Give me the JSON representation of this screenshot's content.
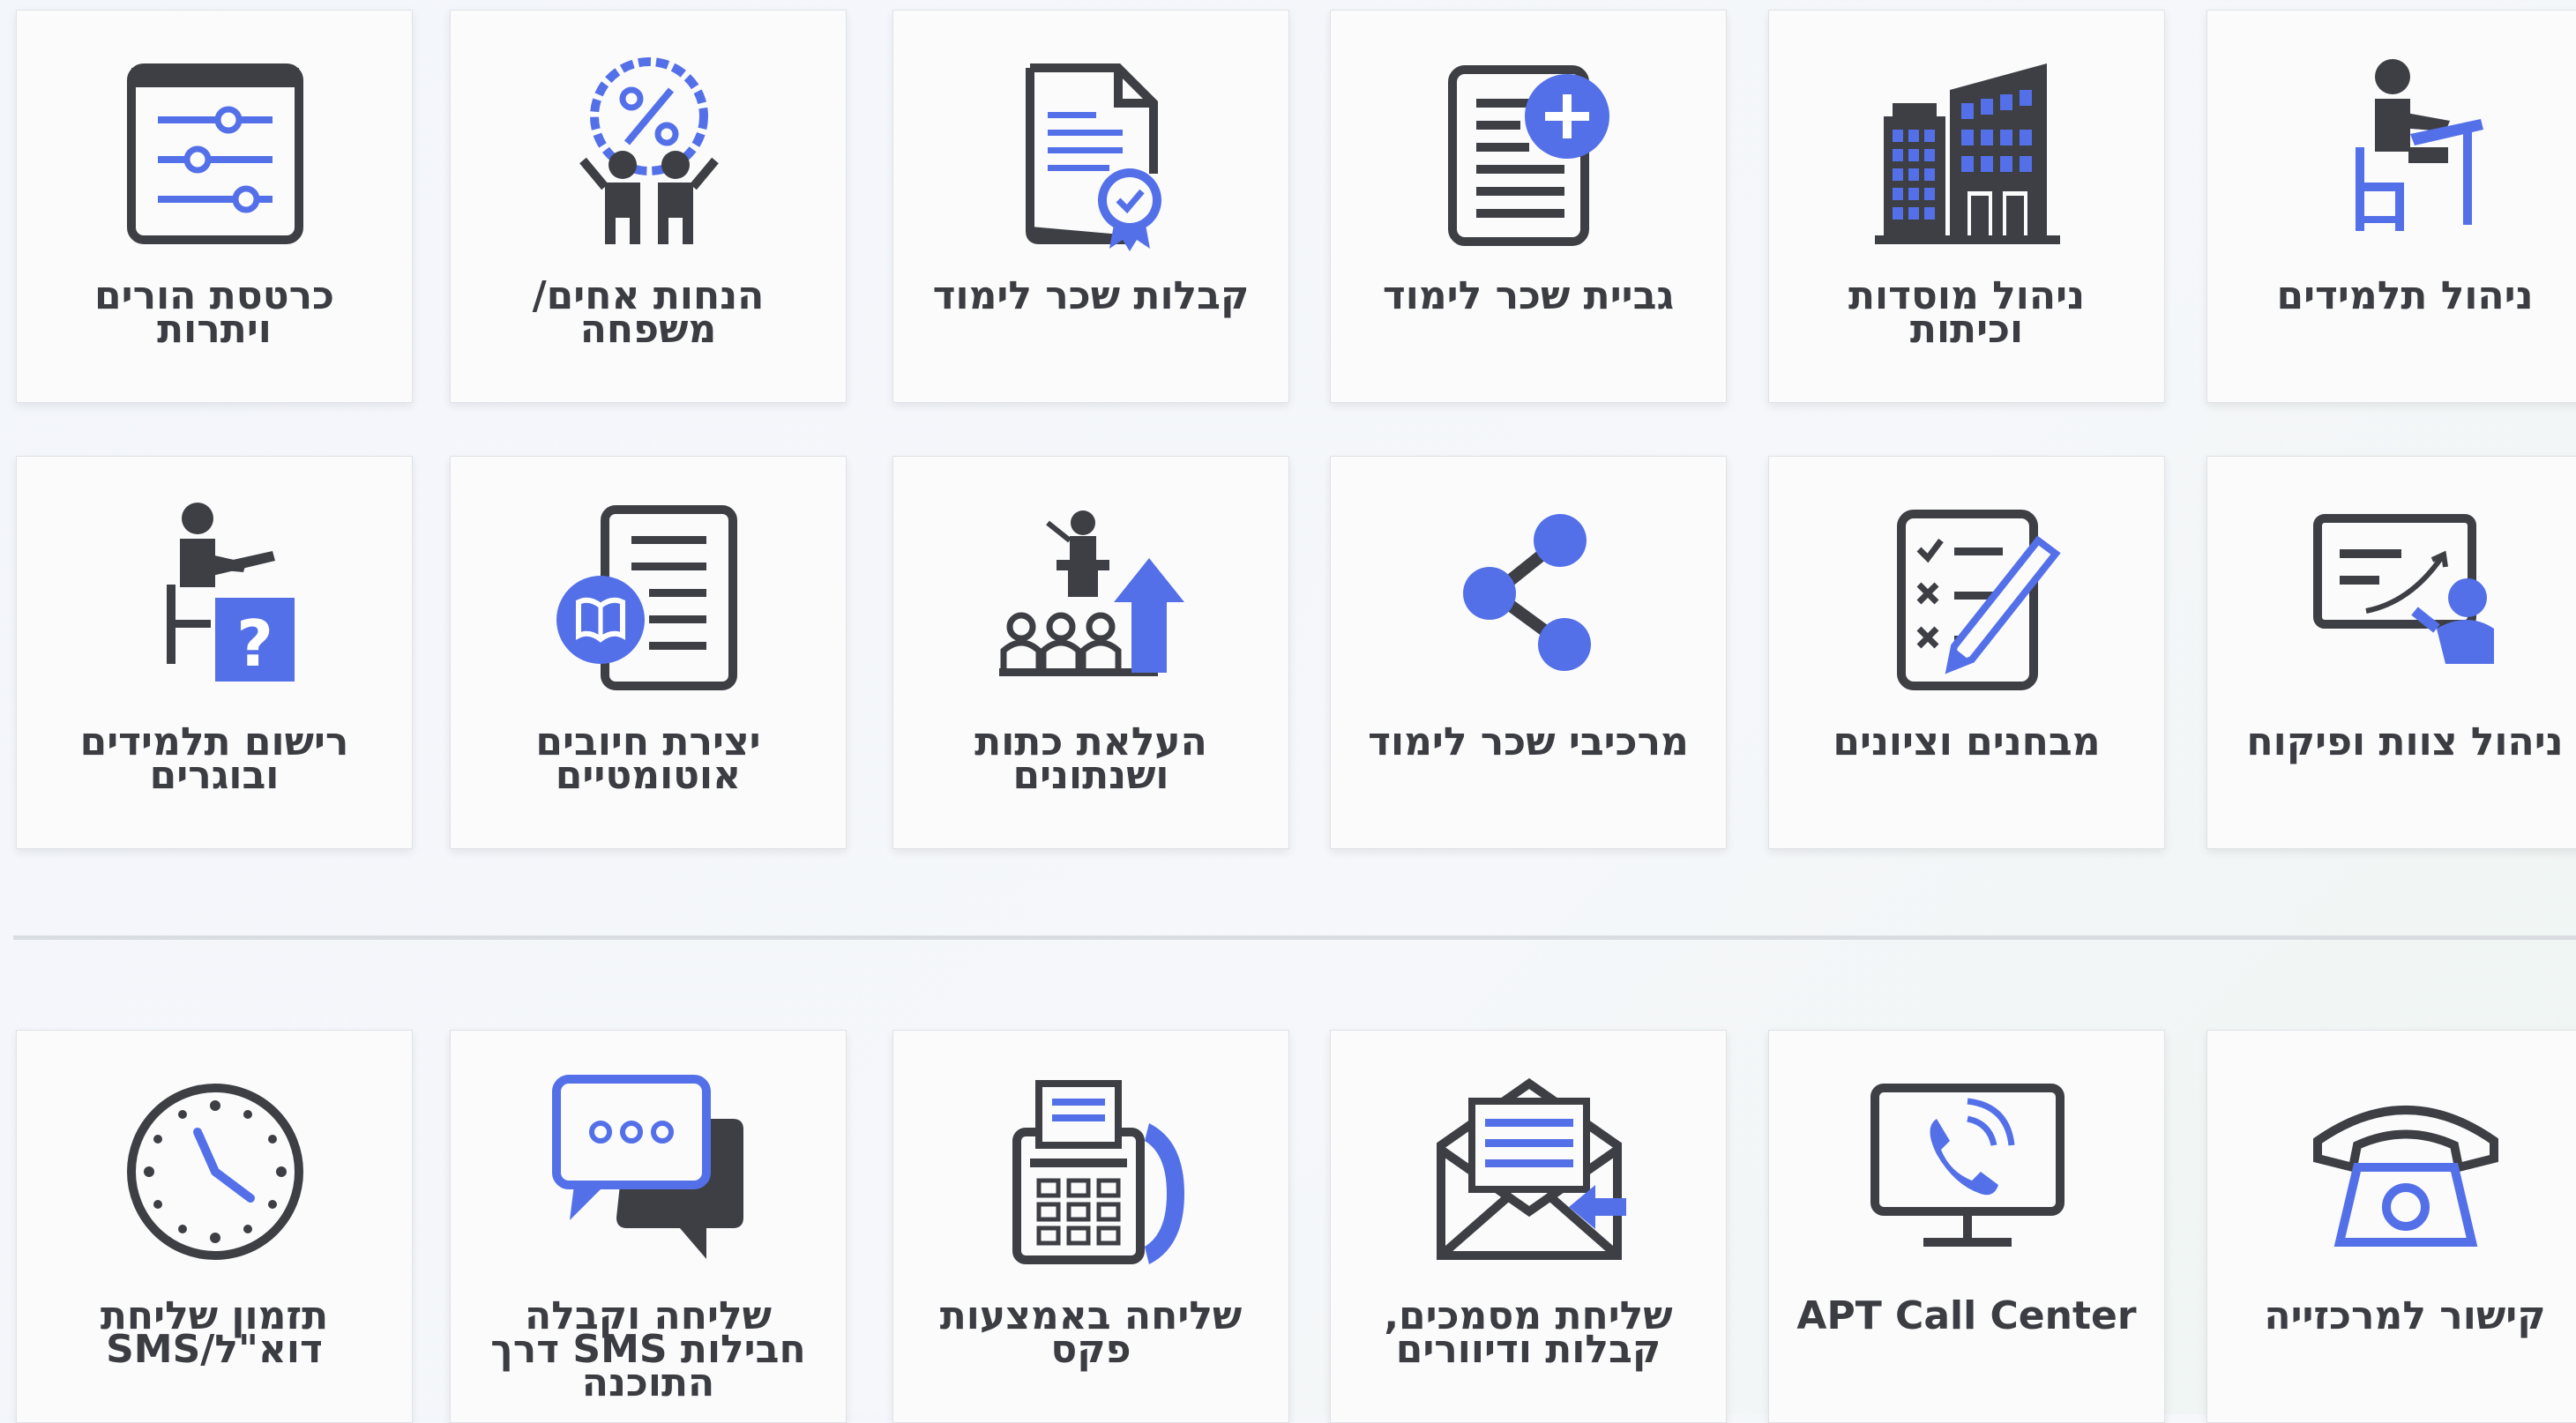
{
  "colors": {
    "accent": "#5470e8",
    "icon_dark": "#3d3f44",
    "label": "#3b3d42"
  },
  "row1": [
    {
      "label": "ניהול תלמידים",
      "icon": "student-desk-icon"
    },
    {
      "label": "ניהול מוסדות וכיתות",
      "icon": "buildings-icon"
    },
    {
      "label": "גביית שכר לימוד",
      "icon": "document-plus-icon"
    },
    {
      "label": "קבלות שכר לימוד",
      "icon": "certificate-document-icon"
    },
    {
      "label": "הנחות אחים/ משפחה",
      "icon": "family-discount-icon"
    },
    {
      "label": "כרטסת הורים ויתרות",
      "icon": "settings-sliders-icon"
    }
  ],
  "row2": [
    {
      "label": "ניהול צוות ופיקוח",
      "icon": "presentation-board-icon"
    },
    {
      "label": "מבחנים וציונים",
      "icon": "checklist-pencil-icon"
    },
    {
      "label": "מרכיבי שכר לימוד",
      "icon": "share-icon"
    },
    {
      "label": "העלאת כתות ושנתונים",
      "icon": "classroom-up-arrow-icon"
    },
    {
      "label": "יצירת חיובים אוטומטיים",
      "icon": "document-book-icon"
    },
    {
      "label": "רישום תלמידים ובוגרים",
      "icon": "student-question-icon"
    }
  ],
  "row3": [
    {
      "label": "קישור למרכזייה",
      "icon": "telephone-icon"
    },
    {
      "label": "APT Call Center",
      "icon": "monitor-phone-icon"
    },
    {
      "label": "שליחת מסמכים, קבלות ודיוורים",
      "icon": "envelope-document-icon"
    },
    {
      "label": "שליחה באמצעות פקס",
      "icon": "fax-machine-icon"
    },
    {
      "label": "שליחה וקבלה חבילות SMS דרך התוכנה",
      "icon": "chat-bubbles-icon"
    },
    {
      "label": "תזמון שליחת דוא\"ל/SMS",
      "icon": "clock-icon"
    }
  ]
}
